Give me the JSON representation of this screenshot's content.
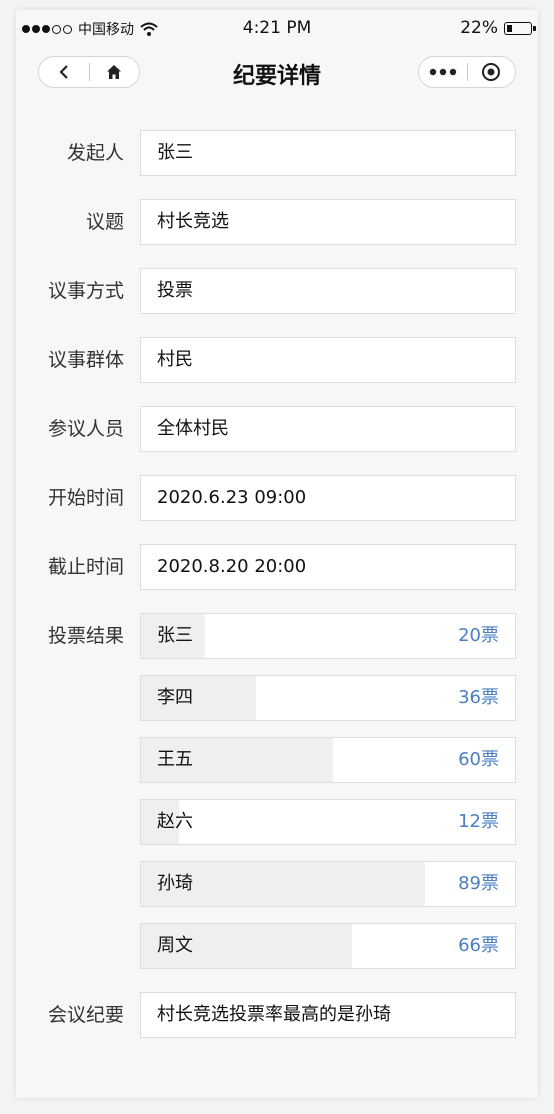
{
  "status": {
    "carrier": "中国移动",
    "time": "4:21 PM",
    "battery_text": "22%",
    "battery_level": 0.22
  },
  "nav": {
    "title": "纪要详情",
    "back_icon": "chevron-left-icon",
    "home_icon": "home-icon",
    "more_icon": "more-dots-icon",
    "close_icon": "target-circle-icon"
  },
  "form": {
    "initiator": {
      "label": "发起人",
      "value": "张三"
    },
    "topic": {
      "label": "议题",
      "value": "村长竞选"
    },
    "method": {
      "label": "议事方式",
      "value": "投票"
    },
    "group": {
      "label": "议事群体",
      "value": "村民"
    },
    "participants": {
      "label": "参议人员",
      "value": "全体村民"
    },
    "start": {
      "label": "开始时间",
      "value": "2020.6.23 09:00"
    },
    "end": {
      "label": "截止时间",
      "value": "2020.8.20 20:00"
    },
    "results_label": "投票结果",
    "results": [
      {
        "name": "张三",
        "votes": 20,
        "count_text": "20票"
      },
      {
        "name": "李四",
        "votes": 36,
        "count_text": "36票"
      },
      {
        "name": "王五",
        "votes": 60,
        "count_text": "60票"
      },
      {
        "name": "赵六",
        "votes": 12,
        "count_text": "12票"
      },
      {
        "name": "孙琦",
        "votes": 89,
        "count_text": "89票"
      },
      {
        "name": "周文",
        "votes": 66,
        "count_text": "66票"
      }
    ],
    "summary": {
      "label": "会议纪要",
      "value": "村长竞选投票率最高的是孙琦"
    }
  },
  "colors": {
    "vote_count": "#4a7fc4",
    "vote_bar": "#efefef"
  }
}
